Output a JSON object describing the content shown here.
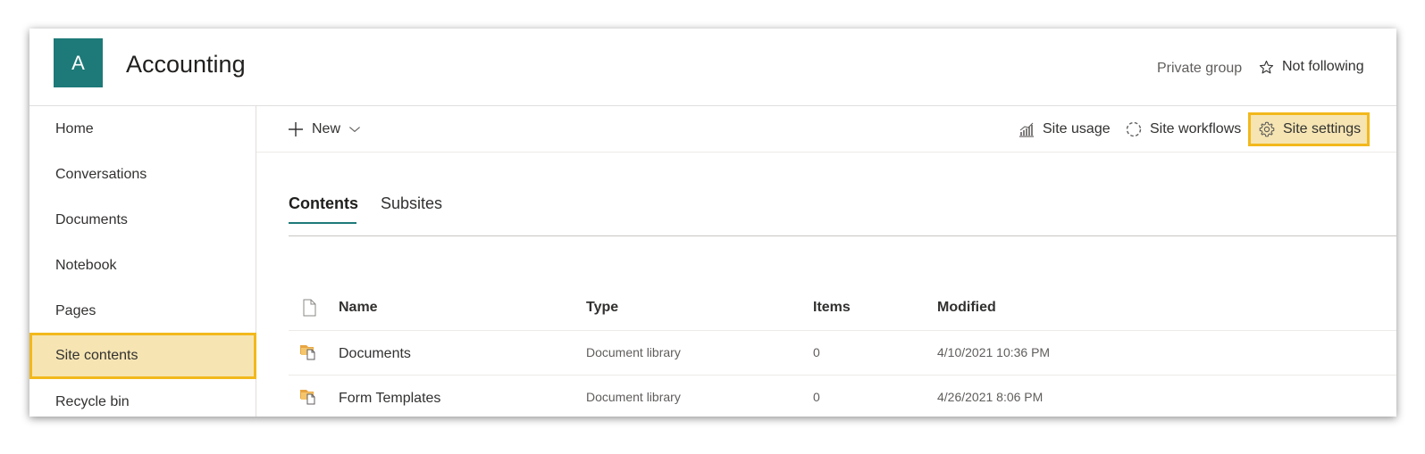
{
  "site": {
    "logo_letter": "A",
    "title": "Accounting",
    "privacy": "Private group",
    "follow": "Not following"
  },
  "nav": {
    "items": [
      {
        "label": "Home"
      },
      {
        "label": "Conversations"
      },
      {
        "label": "Documents"
      },
      {
        "label": "Notebook"
      },
      {
        "label": "Pages"
      },
      {
        "label": "Site contents",
        "selected": true
      },
      {
        "label": "Recycle bin"
      }
    ]
  },
  "commandbar": {
    "new_label": "New",
    "site_usage": "Site usage",
    "site_workflows": "Site workflows",
    "site_settings": "Site settings"
  },
  "tabs": [
    {
      "label": "Contents",
      "active": true
    },
    {
      "label": "Subsites"
    }
  ],
  "table": {
    "headers": {
      "name": "Name",
      "type": "Type",
      "items": "Items",
      "modified": "Modified"
    },
    "rows": [
      {
        "name": "Documents",
        "type": "Document library",
        "items": "0",
        "modified": "4/10/2021 10:36 PM"
      },
      {
        "name": "Form Templates",
        "type": "Document library",
        "items": "0",
        "modified": "4/26/2021 8:06 PM"
      }
    ]
  },
  "colors": {
    "accent": "#1d7a78",
    "highlight_border": "#f2b81c",
    "highlight_fill": "#f6e5b3"
  },
  "icons": {
    "follow": "star-icon",
    "new": "plus-icon",
    "dropdown": "chevron-down-icon",
    "usage": "chart-icon",
    "workflows": "workflow-icon",
    "settings": "gear-icon",
    "file": "document-icon",
    "library": "library-icon"
  }
}
